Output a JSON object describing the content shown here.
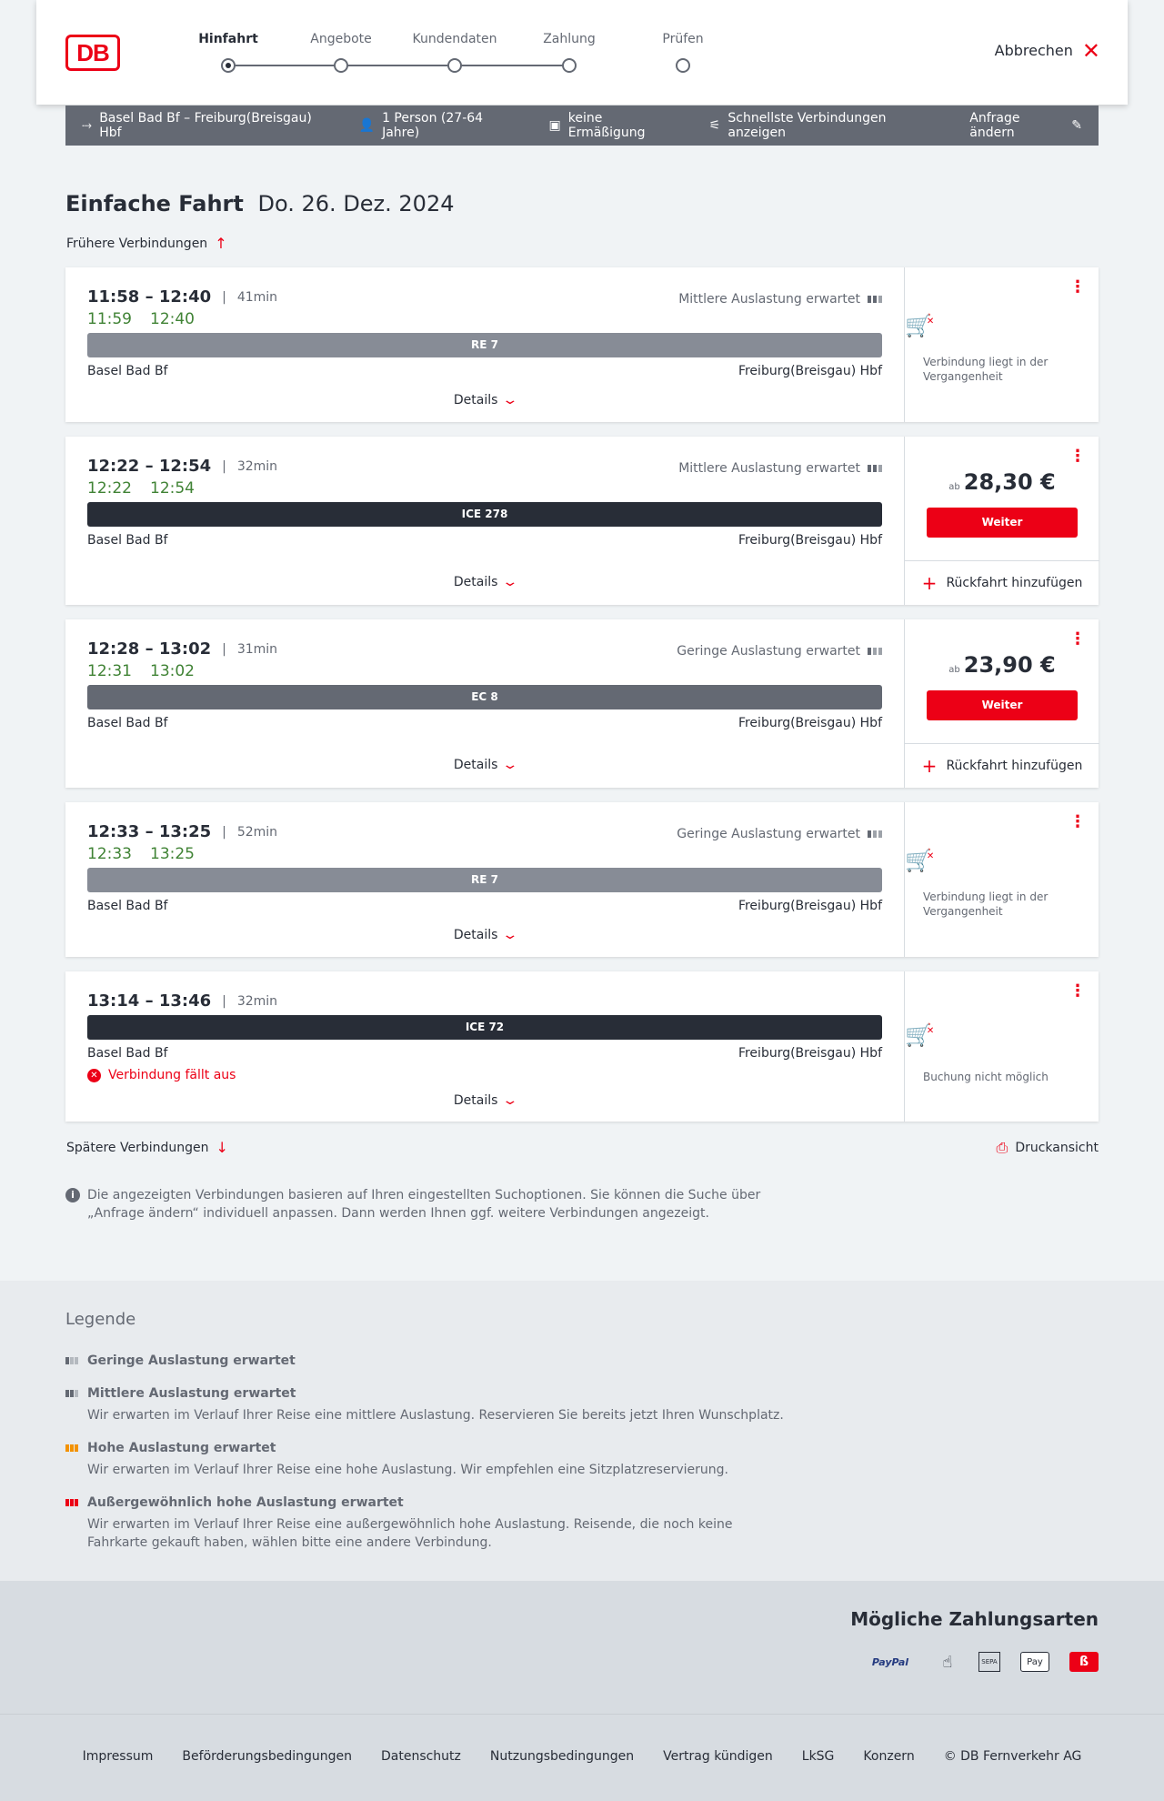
{
  "header": {
    "steps": [
      {
        "label": "Hinfahrt",
        "active": true
      },
      {
        "label": "Angebote",
        "active": false
      },
      {
        "label": "Kundendaten",
        "active": false
      },
      {
        "label": "Zahlung",
        "active": false
      },
      {
        "label": "Prüfen",
        "active": false
      }
    ],
    "cancel_label": "Abbrechen",
    "logo_text": "DB"
  },
  "summary": {
    "route": "Basel Bad Bf – Freiburg(Breisgau) Hbf",
    "passengers": "1 Person (27-64 Jahre)",
    "discount": "keine Ermäßigung",
    "fastest": "Schnellste Verbindungen anzeigen",
    "change": "Anfrage ändern"
  },
  "title": {
    "type": "Einfache Fahrt",
    "date": "Do. 26. Dez. 2024"
  },
  "earlier_label": "Frühere Verbindungen",
  "later_label": "Spätere Verbindungen",
  "print_label": "Druckansicht",
  "details_label": "Details",
  "return_label": "Rückfahrt hinzufügen",
  "weiter_label": "Weiter",
  "price_prefix": "ab",
  "connections": [
    {
      "times": "11:58 – 12:40",
      "duration": "41min",
      "rt_dep": "11:59",
      "rt_arr": "12:40",
      "occupancy": "Mittlere Auslastung erwartet",
      "train": "RE 7",
      "from": "Basel Bad Bf",
      "to": "Freiburg(Breisgau) Hbf",
      "status": "Verbindung liegt in der Vergangenheit"
    },
    {
      "times": "12:22 – 12:54",
      "duration": "32min",
      "rt_dep": "12:22",
      "rt_arr": "12:54",
      "occupancy": "Mittlere Auslastung erwartet",
      "train": "ICE 278",
      "from": "Basel Bad Bf",
      "to": "Freiburg(Breisgau) Hbf",
      "price": "28,30 €"
    },
    {
      "times": "12:28 – 13:02",
      "duration": "31min",
      "rt_dep": "12:31",
      "rt_arr": "13:02",
      "occupancy": "Geringe Auslastung erwartet",
      "train": "EC 8",
      "from": "Basel Bad Bf",
      "to": "Freiburg(Breisgau) Hbf",
      "price": "23,90 €"
    },
    {
      "times": "12:33 – 13:25",
      "duration": "52min",
      "rt_dep": "12:33",
      "rt_arr": "13:25",
      "occupancy": "Geringe Auslastung erwartet",
      "train": "RE 7",
      "from": "Basel Bad Bf",
      "to": "Freiburg(Breisgau) Hbf",
      "status": "Verbindung liegt in der Vergangenheit"
    },
    {
      "times": "13:14 – 13:46",
      "duration": "32min",
      "train": "ICE 72",
      "from": "Basel Bad Bf",
      "to": "Freiburg(Breisgau) Hbf",
      "cancelled": "Verbindung fällt aus",
      "status": "Buchung nicht möglich"
    }
  ],
  "info_text": "Die angezeigten Verbindungen basieren auf Ihren eingestellten Suchoptionen. Sie können die Suche über „Anfrage ändern“ individuell anpassen. Dann werden Ihnen ggf. weitere Verbindungen angezeigt.",
  "legend": {
    "title": "Legende",
    "items": [
      {
        "title": "Geringe Auslastung erwartet",
        "desc": ""
      },
      {
        "title": "Mittlere Auslastung erwartet",
        "desc": "Wir erwarten im Verlauf Ihrer Reise eine mittlere Auslastung. Reservieren Sie bereits jetzt Ihren Wunschplatz."
      },
      {
        "title": "Hohe Auslastung erwartet",
        "desc": "Wir erwarten im Verlauf Ihrer Reise eine hohe Auslastung. Wir empfehlen eine Sitzplatzreservierung."
      },
      {
        "title": "Außergewöhnlich hohe Auslastung erwartet",
        "desc": "Wir erwarten im Verlauf Ihrer Reise eine außergewöhnlich hohe Auslastung. Reisende, die noch keine Fahrkarte gekauft haben, wählen bitte eine andere Verbindung."
      }
    ]
  },
  "payments": {
    "title": "Mögliche Zahlungsarten",
    "methods": [
      "PayPal",
      "SEPA",
      "Pay"
    ]
  },
  "footer": {
    "links": [
      "Impressum",
      "Beförderungsbedingungen",
      "Datenschutz",
      "Nutzungsbedingungen",
      "Vertrag kündigen",
      "LkSG",
      "Konzern",
      "© DB Fernverkehr AG"
    ]
  },
  "colors": {
    "accent": "#ec0016",
    "realtime_green": "#408335",
    "bar_re": "#878c96",
    "bar_ice": "#282d37",
    "bar_ec": "#646973"
  }
}
